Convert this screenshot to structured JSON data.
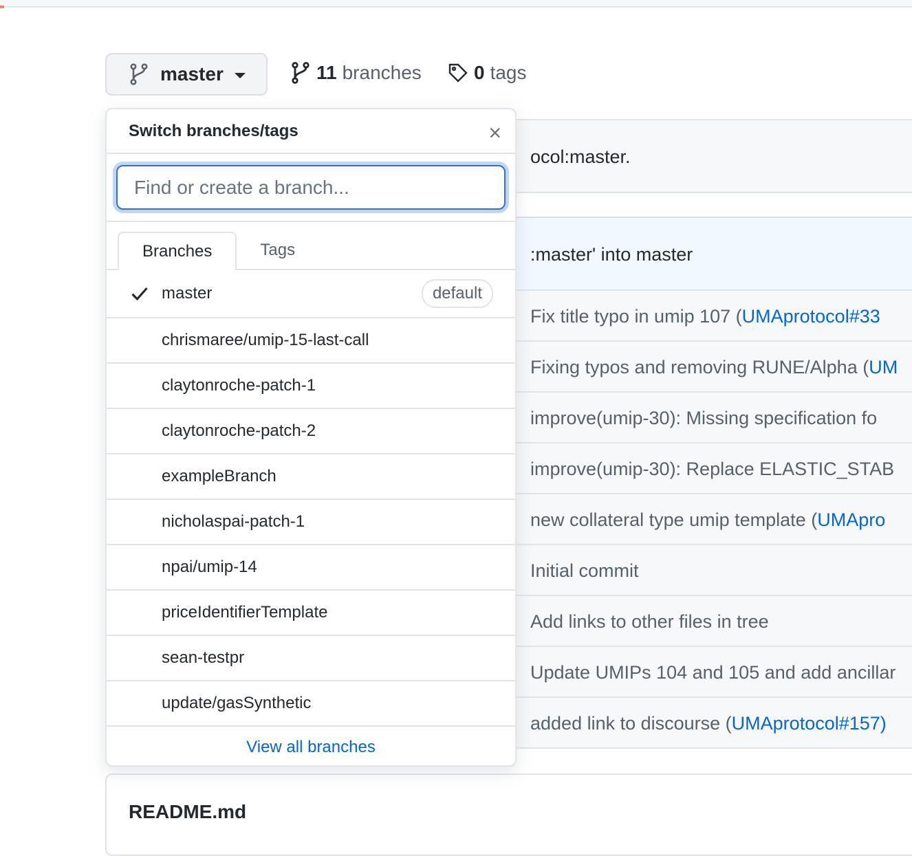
{
  "header": {
    "branch": "master",
    "branches_count": "11",
    "branches_label": "branches",
    "tags_count": "0",
    "tags_label": "tags"
  },
  "background": {
    "notice": "ocol:master.",
    "last_commit": ":master' into master",
    "commits": [
      {
        "text": "Fix title typo in umip 107 (",
        "link": "UMAprotocol#33"
      },
      {
        "text": "Fixing typos and removing RUNE/Alpha (",
        "link": "UM"
      },
      {
        "text": "improve(umip-30): Missing specification fo",
        "link": ""
      },
      {
        "text": "improve(umip-30): Replace ELASTIC_STAB",
        "link": ""
      },
      {
        "text": "new collateral type umip template (",
        "link": "UMApro"
      },
      {
        "text": "Initial commit",
        "link": ""
      },
      {
        "text": "Add links to other files in tree",
        "link": ""
      },
      {
        "text": "Update UMIPs 104 and 105 and add ancillar",
        "link": ""
      },
      {
        "text": "added link to discourse (",
        "link": "UMAprotocol#157)"
      }
    ],
    "readme": "README.md"
  },
  "dropdown": {
    "title": "Switch branches/tags",
    "close": "×",
    "placeholder": "Find or create a branch...",
    "tabs": [
      "Branches",
      "Tags"
    ],
    "default_badge": "default",
    "branches": [
      "master",
      "chrismaree/umip-15-last-call",
      "claytonroche-patch-1",
      "claytonroche-patch-2",
      "exampleBranch",
      "nicholaspai-patch-1",
      "npai/umip-14",
      "priceIdentifierTemplate",
      "sean-testpr",
      "update/gasSynthetic"
    ],
    "view_all": "View all branches"
  }
}
